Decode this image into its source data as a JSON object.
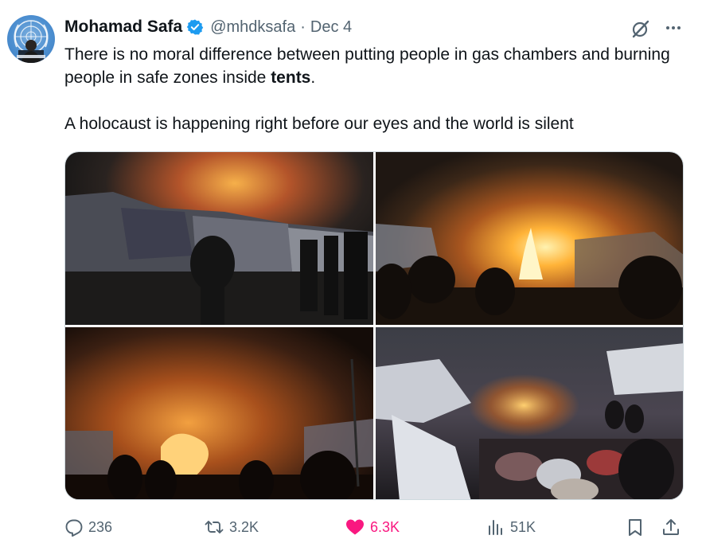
{
  "author": {
    "name": "Mohamad Safa",
    "handle": "@mhdksafa",
    "separator": "·",
    "date": "Dec 4",
    "verified": true
  },
  "tweet": {
    "paragraph1_part1": "There is no moral difference between putting people in gas chambers and burning people in safe zones inside ",
    "paragraph1_bold": "tents",
    "paragraph1_end": ".",
    "paragraph2": "A holocaust is happening right before our eyes and the world is silent"
  },
  "media": {
    "photos": [
      {
        "description": "night fire at tent camp, people walking"
      },
      {
        "description": "flames engulfing tents, silhouettes"
      },
      {
        "description": "smoke and fire behind crowd"
      },
      {
        "description": "burned tents and belongings, crowd"
      }
    ]
  },
  "actions": {
    "replies": "236",
    "reposts": "3.2K",
    "likes": "6.3K",
    "views": "51K"
  },
  "colors": {
    "text_primary": "#0f1419",
    "text_secondary": "#536471",
    "verified_blue": "#1d9bf0",
    "like_pink": "#f91880",
    "border": "#cfd9de"
  },
  "icons": {
    "reply": "reply-icon",
    "repost": "repost-icon",
    "like": "heart-filled-icon",
    "views": "views-chart-icon",
    "bookmark": "bookmark-icon",
    "share": "share-icon",
    "grok": "grok-icon",
    "more": "more-dots-icon"
  }
}
